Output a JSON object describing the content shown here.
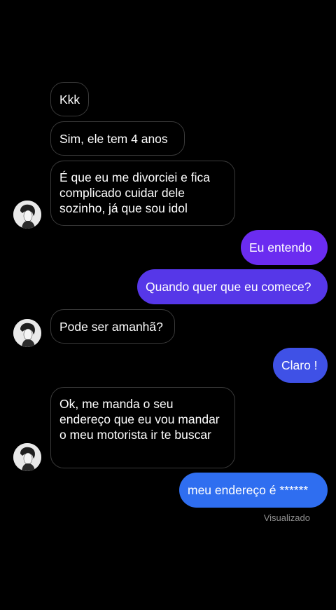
{
  "colors": {
    "background": "#000000",
    "incoming_border": "#3a3a3a",
    "outgoing_purple": "#6b2cf0",
    "outgoing_violet": "#5637e8",
    "outgoing_blue": "#3f51e6",
    "outgoing_bright_blue": "#2f6ef0",
    "seen_text": "#8e8e8e"
  },
  "messages": [
    {
      "direction": "incoming",
      "text": "Kkk"
    },
    {
      "direction": "incoming",
      "text": "Sim, ele tem 4 anos"
    },
    {
      "direction": "incoming",
      "text": "É que eu me divorciei e fica complicado cuidar dele sozinho, já que sou idol"
    },
    {
      "direction": "outgoing",
      "text": "Eu entendo"
    },
    {
      "direction": "outgoing",
      "text": "Quando quer que eu comece?"
    },
    {
      "direction": "incoming",
      "text": "Pode ser amanhã?"
    },
    {
      "direction": "outgoing",
      "text": "Claro !"
    },
    {
      "direction": "incoming",
      "text": "Ok, me manda o seu endereço que eu vou mandar o meu motorista ir te buscar"
    },
    {
      "direction": "outgoing",
      "text": "meu endereço é ******"
    }
  ],
  "status": {
    "seen_label": "Visualizado"
  },
  "avatar": {
    "icon": "profile-photo-icon"
  }
}
